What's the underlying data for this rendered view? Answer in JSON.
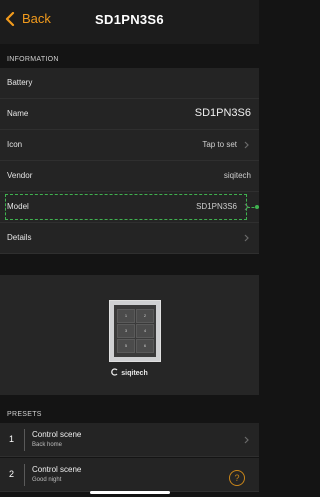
{
  "nav": {
    "back_label": "Back",
    "title": "SD1PN3S6"
  },
  "colors": {
    "accent": "#f19a1c",
    "highlight": "#3fb24f",
    "background": "#141414",
    "row": "#242424"
  },
  "information": {
    "header": "INFORMATION",
    "battery_label": "Battery",
    "name_label": "Name",
    "name_value": "SD1PN3S6",
    "icon_label": "Icon",
    "icon_value": "Tap to set",
    "vendor_label": "Vendor",
    "vendor_value": "siqitech",
    "model_label": "Model",
    "model_value": "SD1PN3S6",
    "details_label": "Details"
  },
  "device_image": {
    "buttons": [
      "1",
      "2",
      "3",
      "4",
      "5",
      "6"
    ],
    "brand": "siqitech"
  },
  "presets": {
    "header": "PRESETS",
    "items": [
      {
        "number": "1",
        "title": "Control scene",
        "subtitle": "Back home"
      },
      {
        "number": "2",
        "title": "Control scene",
        "subtitle": "Good night"
      }
    ]
  },
  "icons": {
    "back": "chevron-left-icon",
    "disclosure": "chevron-right-icon",
    "help": "question-circle-icon"
  }
}
